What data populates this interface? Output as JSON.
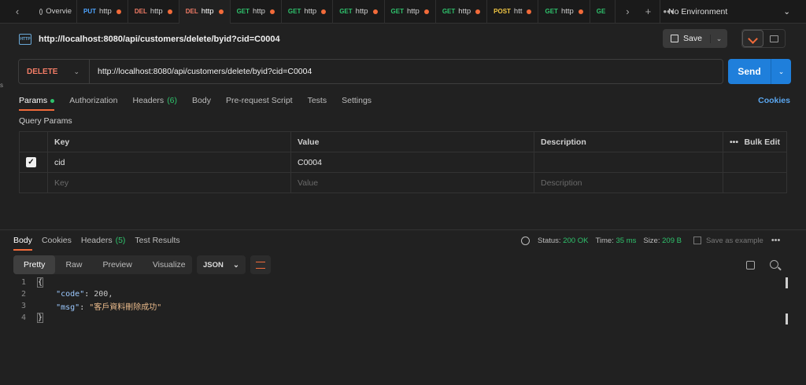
{
  "tabbar": {
    "overview_label": "Overvie",
    "tabs": [
      {
        "method": "PUT",
        "label": "http",
        "method_color": "#4da3ff"
      },
      {
        "method": "DEL",
        "label": "http",
        "method_color": "#f27c66"
      },
      {
        "method": "DEL",
        "label": "http",
        "method_color": "#f27c66",
        "active": true
      },
      {
        "method": "GET",
        "label": "http",
        "method_color": "#2fc26c"
      },
      {
        "method": "GET",
        "label": "http",
        "method_color": "#2fc26c"
      },
      {
        "method": "GET",
        "label": "http",
        "method_color": "#2fc26c"
      },
      {
        "method": "GET",
        "label": "http",
        "method_color": "#2fc26c"
      },
      {
        "method": "GET",
        "label": "http",
        "method_color": "#2fc26c"
      },
      {
        "method": "POST",
        "label": "htt",
        "method_color": "#f2c744"
      },
      {
        "method": "GET",
        "label": "http",
        "method_color": "#2fc26c"
      },
      {
        "method": "GE",
        "label": "",
        "method_color": "#2fc26c"
      }
    ],
    "environment": "No Environment"
  },
  "request": {
    "title": "http://localhost:8080/api/customers/delete/byid?cid=C0004",
    "save_label": "Save",
    "method": "DELETE",
    "url": "http://localhost:8080/api/customers/delete/byid?cid=C0004",
    "send_label": "Send",
    "http_icon_text": "HTTP"
  },
  "request_tabs": {
    "params": "Params",
    "authorization": "Authorization",
    "headers": "Headers",
    "headers_count": "(6)",
    "body": "Body",
    "prerequest": "Pre-request Script",
    "tests": "Tests",
    "settings": "Settings",
    "cookies": "Cookies"
  },
  "query_params": {
    "label": "Query Params",
    "headers": {
      "key": "Key",
      "value": "Value",
      "description": "Description",
      "bulk_edit": "Bulk Edit"
    },
    "rows": [
      {
        "key": "cid",
        "value": "C0004",
        "description": "",
        "checked": true
      }
    ],
    "placeholders": {
      "key": "Key",
      "value": "Value",
      "description": "Description"
    }
  },
  "response": {
    "tabs": {
      "body": "Body",
      "cookies": "Cookies",
      "headers": "Headers",
      "headers_count": "(5)",
      "test_results": "Test Results"
    },
    "status_label": "Status:",
    "status_value": "200 OK",
    "time_label": "Time:",
    "time_value": "35 ms",
    "size_label": "Size:",
    "size_value": "209 B",
    "save_example": "Save as example",
    "view_tabs": [
      "Pretty",
      "Raw",
      "Preview",
      "Visualize"
    ],
    "format": "JSON",
    "lines": [
      {
        "num": "1"
      },
      {
        "num": "2",
        "key": "\"code\"",
        "value": "200,"
      },
      {
        "num": "3",
        "key": "\"msg\"",
        "value": "\"客戶資料刪除成功\""
      },
      {
        "num": "4"
      }
    ]
  }
}
